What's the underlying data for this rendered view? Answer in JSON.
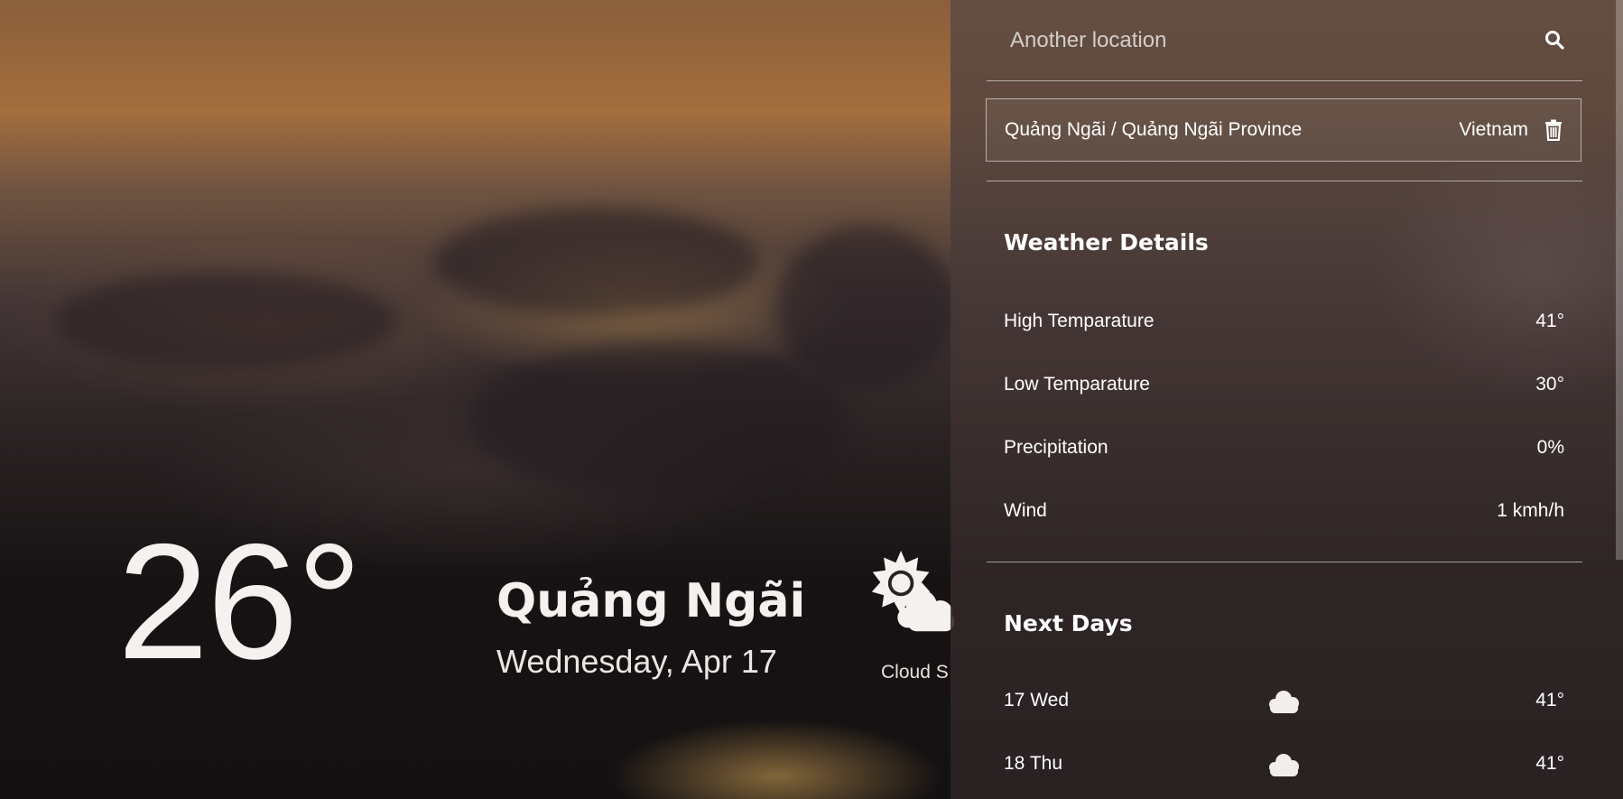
{
  "current": {
    "temperature": "26°",
    "city": "Quảng Ngãi",
    "date": "Wednesday, Apr 17",
    "condition_label": "Cloud S",
    "condition_icon": "sun-cloud-icon"
  },
  "search": {
    "placeholder": "Another location",
    "icon": "search-icon"
  },
  "saved_location": {
    "name": "Quảng Ngãi / Quảng Ngãi Province",
    "country": "Vietnam",
    "delete_icon": "trash-icon"
  },
  "details": {
    "title": "Weather Details",
    "rows": [
      {
        "label": "High Temparature",
        "value": "41°"
      },
      {
        "label": "Low Temparature",
        "value": "30°"
      },
      {
        "label": "Precipitation",
        "value": "0%"
      },
      {
        "label": "Wind",
        "value": "1 kmh/h"
      }
    ]
  },
  "next_days": {
    "title": "Next Days",
    "days": [
      {
        "day": "17 Wed",
        "icon": "cloud-icon",
        "temp": "41°"
      },
      {
        "day": "18 Thu",
        "icon": "cloud-icon",
        "temp": "41°"
      }
    ]
  }
}
